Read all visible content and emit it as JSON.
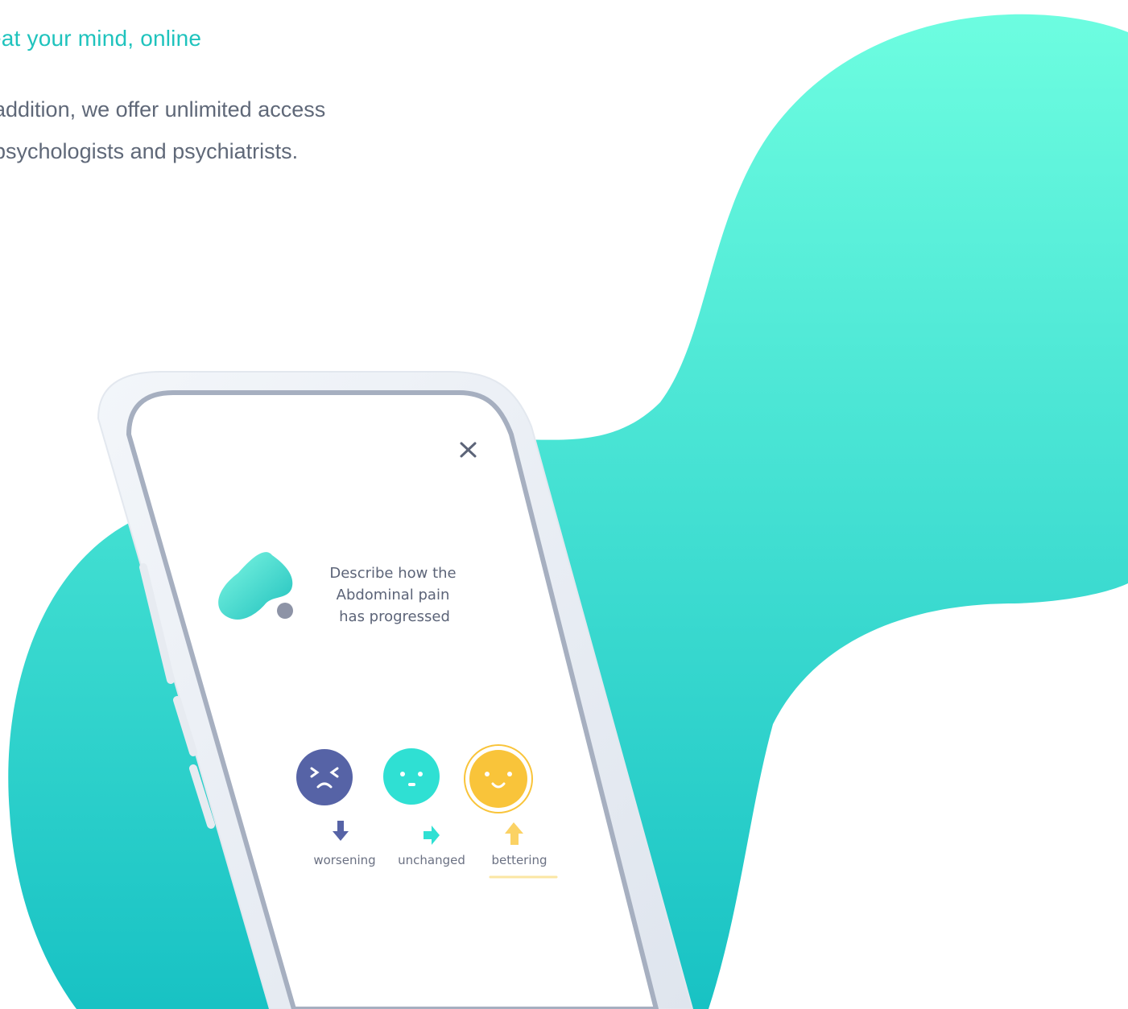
{
  "hero": {
    "headline": "eat your mind, online",
    "body": "addition, we offer unlimited access psychologists and psychiatrists."
  },
  "colors": {
    "accent_teal": "#1fc3bd",
    "blob_top": "#6dfde0",
    "blob_bottom": "#18c2c4",
    "text_gray": "#5f6878",
    "worsening": "#5663a6",
    "unchanged": "#2fe0d3",
    "bettering": "#f9c43a"
  },
  "phone": {
    "close_icon": "close-icon",
    "logo_icon": "brand-blob-icon",
    "prompt_lines": [
      "Describe how the",
      "Abdominal pain",
      "has progressed"
    ],
    "options": [
      {
        "label": "worsening",
        "face": "frowning-face-icon",
        "arrow": "arrow-down-icon",
        "selected": false
      },
      {
        "label": "unchanged",
        "face": "neutral-face-icon",
        "arrow": "arrow-right-icon",
        "selected": false
      },
      {
        "label": "bettering",
        "face": "smiling-face-icon",
        "arrow": "arrow-up-icon",
        "selected": true
      }
    ]
  }
}
